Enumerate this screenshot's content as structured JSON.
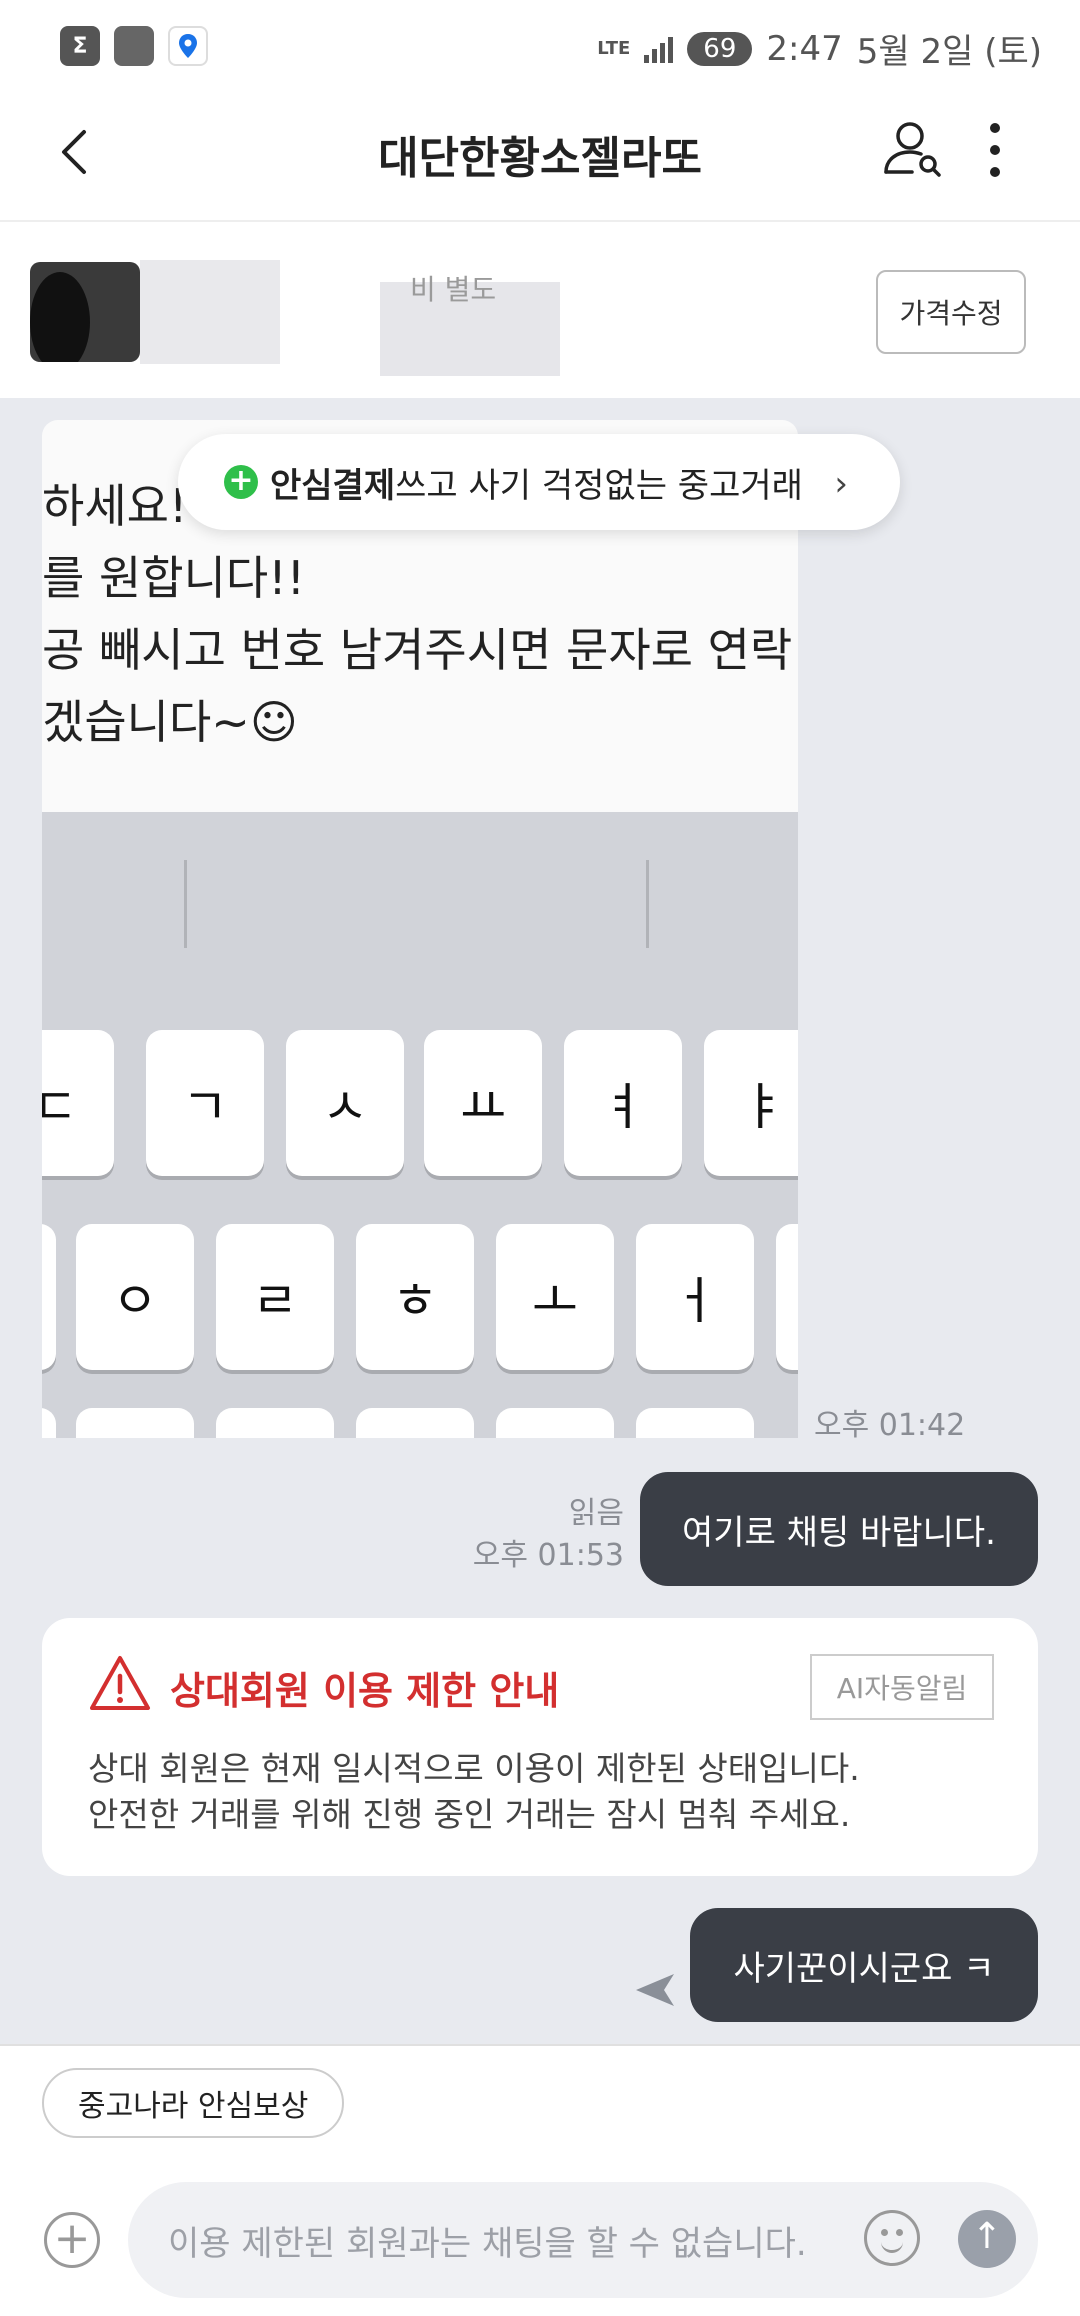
{
  "status_bar": {
    "time": "2:47",
    "date": "5월 2일 (토)",
    "battery": "69",
    "network": "LTE",
    "icons": [
      "sigma-app-icon",
      "tracker-manager-icon",
      "location-icon"
    ]
  },
  "header": {
    "title": "대단한황소젤라또",
    "icons": [
      "back-arrow-icon",
      "user-search-icon",
      "more-vertical-icon"
    ]
  },
  "product": {
    "visible_text": "비 별도",
    "edit_price_label": "가격수정"
  },
  "banner": {
    "bold": "안심결제",
    "text": "쓰고 사기 걱정없는 중고거래"
  },
  "image_message": {
    "text": "하세요!\n를 원합니다!!\n공 빼시고 번호 남겨주시면 문자로 연락\n겠습니다~☺",
    "keyboard_row1": [
      "ㄷ",
      "ㄱ",
      "ㅅ",
      "ㅛ",
      "ㅕ",
      "ㅑ"
    ],
    "keyboard_row2": [
      "ㅇ",
      "ㄹ",
      "ㅎ",
      "ㅗ",
      "ㅓ"
    ],
    "time": "오후 01:42"
  },
  "my_message_1": {
    "text": "여기로 채팅 바랍니다.",
    "read": "읽음",
    "time": "오후 01:53"
  },
  "notice": {
    "title": "상대회원 이용 제한 안내",
    "tag": "AI자동알림",
    "body": "상대 회원은 현재 일시적으로 이용이 제한된 상태입니다.\n안전한 거래를 위해 진행 중인 거래는 잠시 멈춰 주세요."
  },
  "my_message_2": {
    "text": "사기꾼이시군요 ㅋ"
  },
  "bottom": {
    "chip_label": "중고나라 안심보상",
    "input_placeholder": "이용 제한된 회원과는 채팅을 할 수 없습니다.",
    "icons": [
      "plus-icon",
      "emoji-icon",
      "send-arrow-icon"
    ]
  },
  "colors": {
    "chat_bg": "#e8eaef",
    "bubble": "#3a3e46",
    "notice_title": "#d32f2f",
    "safe_pay_green": "#2fbf4a"
  }
}
